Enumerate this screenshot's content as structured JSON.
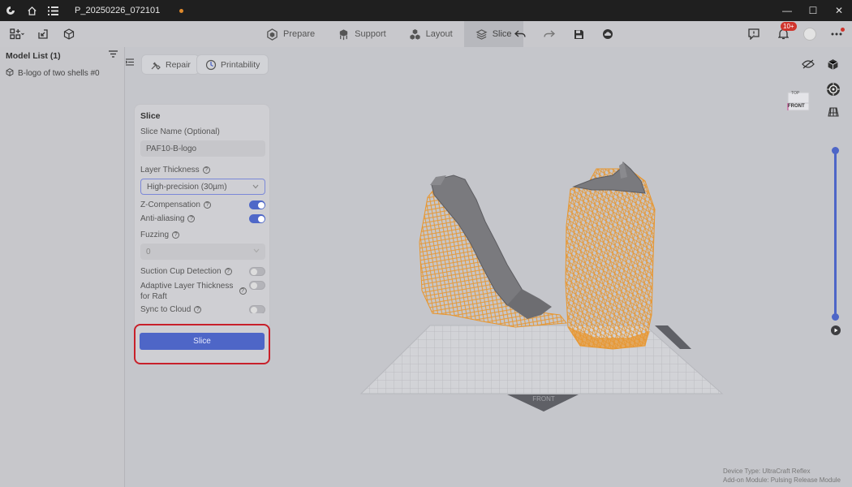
{
  "window": {
    "title": "P_20250226_072101"
  },
  "toolbar": {
    "tabs": [
      {
        "label": "Prepare"
      },
      {
        "label": "Support"
      },
      {
        "label": "Layout"
      },
      {
        "label": "Slice"
      }
    ],
    "notification_badge": "10+"
  },
  "model_list": {
    "title": "Model List (1)",
    "items": [
      {
        "label": "B-logo of two shells #0"
      }
    ]
  },
  "viewport": {
    "repair_label": "Repair",
    "printability_label": "Printability",
    "cube_top": "TOP",
    "cube_front": "FRONT",
    "plate_front": "FRONT"
  },
  "slice_panel": {
    "title": "Slice",
    "name_label": "Slice Name (Optional)",
    "name_value": "PAF10-B-logo",
    "layer_label": "Layer Thickness",
    "layer_value": "High-precision (30µm)",
    "z_comp_label": "Z-Compensation",
    "z_comp_on": true,
    "aa_label": "Anti-aliasing",
    "aa_on": true,
    "fuzzing_label": "Fuzzing",
    "fuzzing_value": "0",
    "suction_label": "Suction Cup Detection",
    "suction_on": false,
    "adaptive_label": "Adaptive Layer Thickness for Raft",
    "adaptive_on": false,
    "sync_label": "Sync to Cloud",
    "sync_on": false,
    "slice_button": "Slice"
  },
  "device_info": {
    "device_type": "Device Type:  UltraCraft Reflex",
    "addon": "Add-on Module:  Pulsing Release Module"
  },
  "colors": {
    "accent": "#4e66c7",
    "support": "#e8962e",
    "model": "#7a7a7e",
    "highlight": "#c8202a"
  }
}
